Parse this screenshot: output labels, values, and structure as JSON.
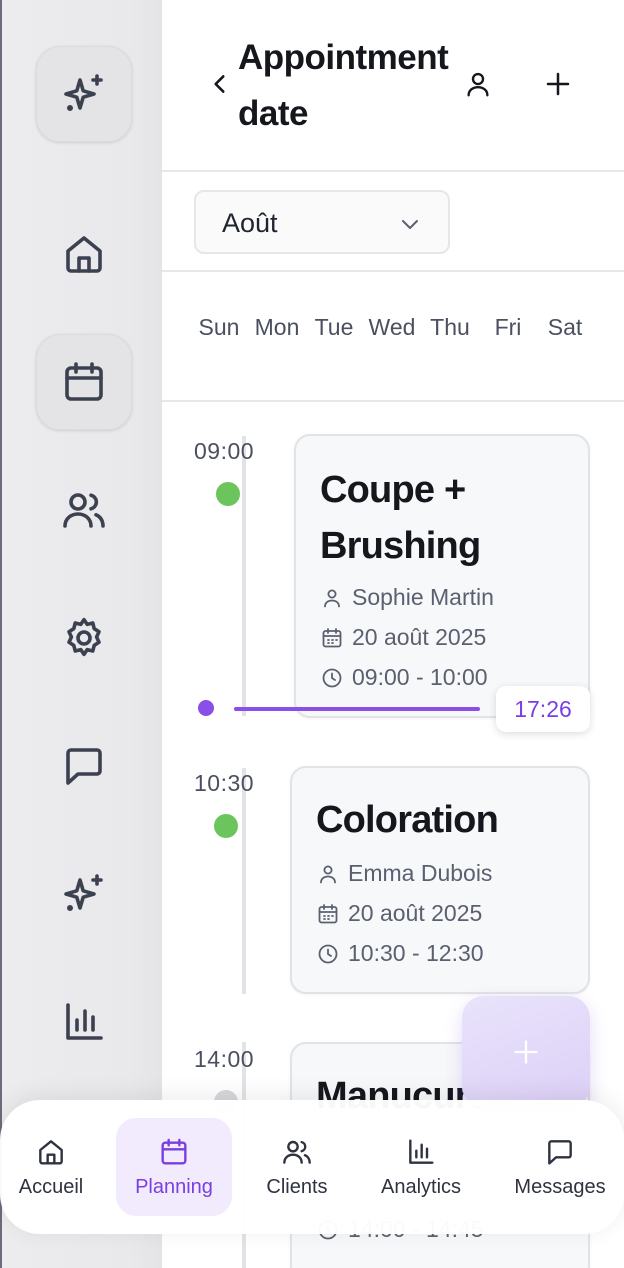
{
  "header": {
    "title": "Appointment date",
    "back_icon": "chevron-left-icon",
    "profile_icon": "user-icon",
    "add_icon": "plus-icon"
  },
  "sidebar": {
    "items": [
      {
        "icon": "sparkles-icon",
        "boxed": true
      },
      {
        "icon": "home-icon",
        "boxed": false
      },
      {
        "icon": "calendar-icon",
        "boxed": true
      },
      {
        "icon": "users-icon",
        "boxed": false
      },
      {
        "icon": "gear-icon",
        "boxed": false
      },
      {
        "icon": "message-icon",
        "boxed": false
      },
      {
        "icon": "sparkles-icon",
        "boxed": false
      },
      {
        "icon": "bar-chart-icon",
        "boxed": false
      }
    ]
  },
  "month_select": {
    "value": "Août"
  },
  "weekdays": [
    "Sun",
    "Mon",
    "Tue",
    "Wed",
    "Thu",
    "Fri",
    "Sat"
  ],
  "current_time": "17:26",
  "appointments": [
    {
      "time": "09:00",
      "title": "Coupe + Brushing",
      "client": "Sophie Martin",
      "date": "20 août 2025",
      "range": "09:00 - 10:00",
      "status_color": "#6cc45c"
    },
    {
      "time": "10:30",
      "title": "Coloration",
      "client": "Emma Dubois",
      "date": "20 août 2025",
      "range": "10:30 - 12:30",
      "status_color": "#6cc45c"
    },
    {
      "time": "14:00",
      "title": "Manucure",
      "range": "14:00 - 14:45",
      "status_color": "#d6d7db"
    }
  ],
  "fab": {
    "icon": "plus-icon"
  },
  "bottom_nav": {
    "items": [
      {
        "label": "Accueil",
        "icon": "home-icon",
        "active": false
      },
      {
        "label": "Planning",
        "icon": "calendar-icon",
        "active": true
      },
      {
        "label": "Clients",
        "icon": "users-icon",
        "active": false
      },
      {
        "label": "Analytics",
        "icon": "bar-chart-icon",
        "active": false
      },
      {
        "label": "Messages",
        "icon": "message-icon",
        "active": false
      }
    ]
  },
  "colors": {
    "accent": "#8a4fe8",
    "status_confirmed": "#6cc45c",
    "status_pending": "#d6d7db"
  }
}
